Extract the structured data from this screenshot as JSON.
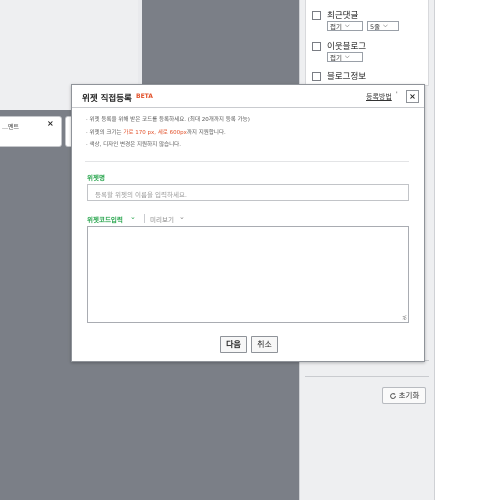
{
  "background_widget": {
    "label": "…멘트",
    "close_glyph": "×"
  },
  "right_panel": {
    "items": [
      {
        "label": "최근댓글",
        "select1": "접기",
        "select2": "5줄"
      },
      {
        "label": "이웃블로그",
        "select1": "접기"
      },
      {
        "label": "블로그정보"
      }
    ],
    "reset_label": "초기화",
    "reset_icon": "refresh-icon"
  },
  "dialog": {
    "title": "위젯 직접등록",
    "beta": "BETA",
    "help_link": "등록방법",
    "help_mark": "'",
    "close_glyph": "×",
    "notes": [
      {
        "text": "위젯 등록을 위해 받은 코드를 등록하세요. (최대 20개까지 등록 가능)"
      },
      {
        "pre": "위젯의 크기는 ",
        "hl": "가로 170 px, 세로 600px",
        "post": "까지 지원합니다."
      },
      {
        "text": "색상, 디자인 변경은 지원하지 않습니다."
      }
    ],
    "name_label": "위젯명",
    "name_placeholder": "등록할 위젯의 이름을 입력하세요.",
    "code_tab_label": "위젯코드입력",
    "preview_tab_label": "미리보기",
    "code_value": "",
    "next_label": "다음",
    "cancel_label": "취소",
    "accent_color": "#2aa64f",
    "highlight_color": "#e2512a"
  }
}
